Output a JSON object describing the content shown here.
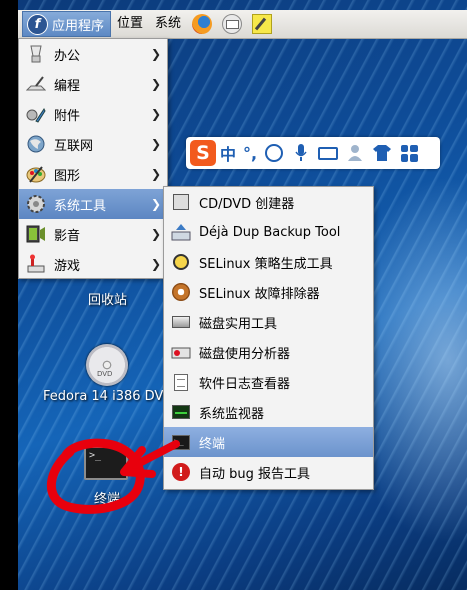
{
  "panel": {
    "apps_label": "应用程序",
    "places_label": "位置",
    "system_label": "系统",
    "logo_letter": "f"
  },
  "menu": {
    "items": [
      {
        "label": "办公",
        "icon": "office-icon"
      },
      {
        "label": "编程",
        "icon": "programming-icon"
      },
      {
        "label": "附件",
        "icon": "accessories-icon"
      },
      {
        "label": "互联网",
        "icon": "internet-icon"
      },
      {
        "label": "图形",
        "icon": "graphics-icon"
      },
      {
        "label": "系统工具",
        "icon": "system-tools-icon"
      },
      {
        "label": "影音",
        "icon": "multimedia-icon"
      },
      {
        "label": "游戏",
        "icon": "games-icon"
      }
    ],
    "arrow": "❯"
  },
  "submenu": {
    "items": [
      {
        "label": "CD/DVD 创建器",
        "icon": "cd-creator-icon"
      },
      {
        "label": "Déjà Dup Backup Tool",
        "icon": "backup-icon"
      },
      {
        "label": "SELinux 策略生成工具",
        "icon": "selinux-policy-icon"
      },
      {
        "label": "SELinux 故障排除器",
        "icon": "selinux-troubleshoot-icon"
      },
      {
        "label": "磁盘实用工具",
        "icon": "disk-utility-icon"
      },
      {
        "label": "磁盘使用分析器",
        "icon": "disk-analyzer-icon"
      },
      {
        "label": "软件日志查看器",
        "icon": "log-viewer-icon"
      },
      {
        "label": "系统监视器",
        "icon": "system-monitor-icon"
      },
      {
        "label": "终端",
        "icon": "terminal-icon"
      },
      {
        "label": "自动 bug 报告工具",
        "icon": "bug-report-icon"
      }
    ],
    "highlighted_index": 8
  },
  "ime": {
    "logo": "S",
    "mode_label": "中",
    "punct_label": "°,"
  },
  "desktop": {
    "trash_label": "回收站",
    "dvd_label": "Fedora 14 i386 DVD",
    "terminal_label": "终端",
    "terminal_prompt": ">_"
  },
  "colors": {
    "menu_highlight": "#5c86c2",
    "annotation_red": "#e8000d",
    "ime_blue": "#1f5fb3",
    "ime_logo": "#f25a1d"
  }
}
